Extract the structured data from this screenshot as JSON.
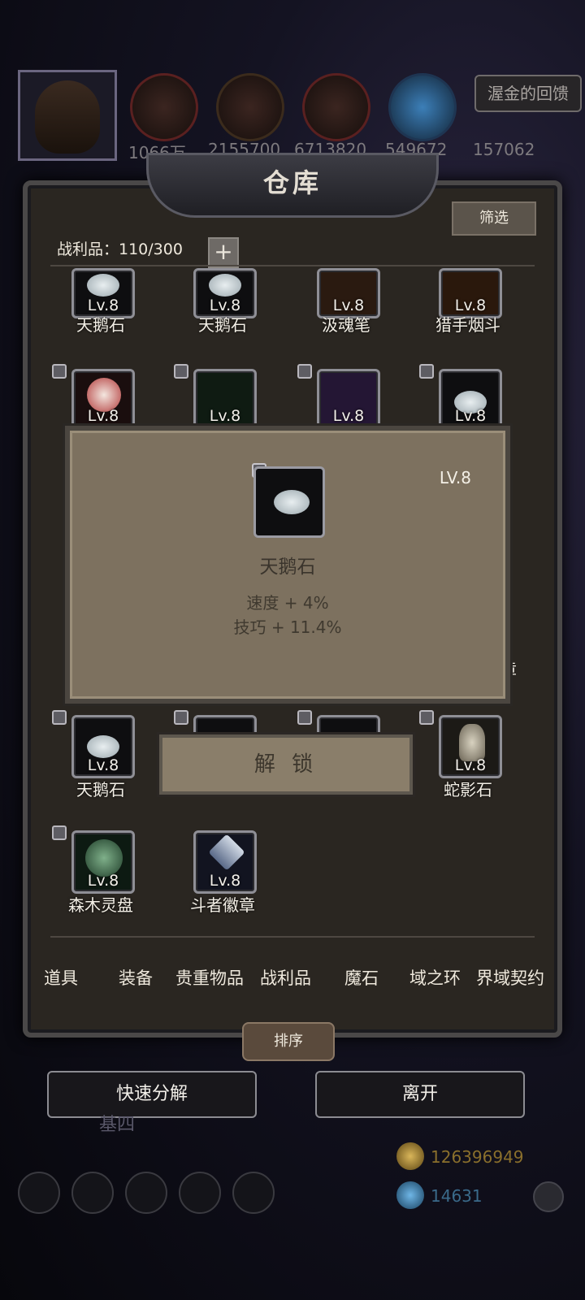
{
  "resources": {
    "values": [
      "1066万",
      "2155700",
      "6713820",
      "549672",
      "157062"
    ],
    "reward_button": "渥金的回馈"
  },
  "warehouse": {
    "title": "仓库",
    "filter_label": "筛选",
    "loot_count": "战利品：110/300",
    "plus": "+"
  },
  "grid_items": [
    {
      "name": "天鹅石",
      "level": "Lv.8",
      "locked": false
    },
    {
      "name": "天鹅石",
      "level": "Lv.8",
      "locked": false
    },
    {
      "name": "汲魂笔",
      "level": "Lv.8",
      "locked": false
    },
    {
      "name": "猎手烟斗",
      "level": "Lv.8",
      "locked": false
    },
    {
      "name": "",
      "level": "Lv.8",
      "locked": true
    },
    {
      "name": "",
      "level": "Lv.8",
      "locked": true
    },
    {
      "name": "",
      "level": "Lv.8",
      "locked": true
    },
    {
      "name": "",
      "level": "Lv.8",
      "locked": true
    },
    {
      "name": "天鹅石",
      "level": "Lv.8",
      "locked": true
    },
    {
      "name": "蛇影石",
      "level": "Lv.8",
      "locked": true
    },
    {
      "name": "森木灵盘",
      "level": "Lv.8",
      "locked": true
    },
    {
      "name": "斗者徽章",
      "level": "Lv.8",
      "locked": false
    }
  ],
  "partial_text": "章",
  "popup": {
    "level": "LV.8",
    "name": "天鹅石",
    "stat1": "速度 + 4%",
    "stat2": "技巧 + 11.4%",
    "unlock_button": "解 锁"
  },
  "tabs": [
    "道具",
    "装备",
    "贵重物品",
    "战利品",
    "魔石",
    "域之环",
    "界域契约"
  ],
  "sort_button": "排序",
  "quick_decompose": "快速分解",
  "leave": "离开",
  "background_label": "基四",
  "currency": {
    "gold": "126396949",
    "gems": "14631"
  }
}
